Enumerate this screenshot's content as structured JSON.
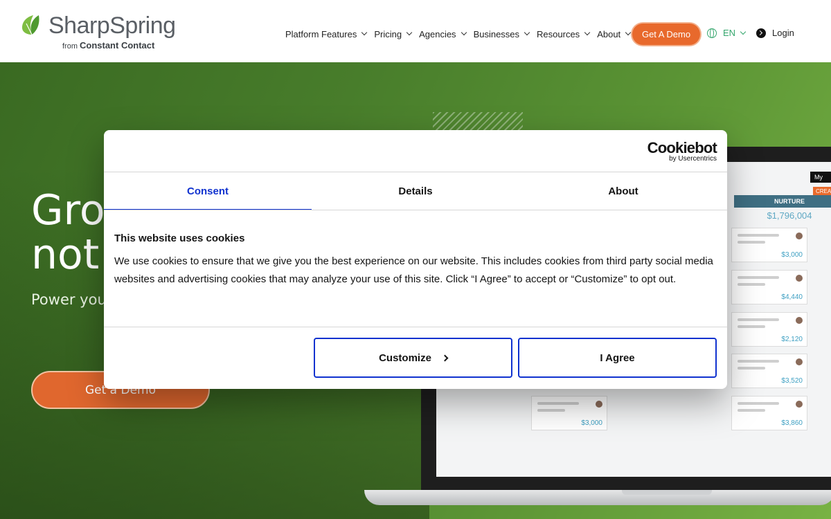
{
  "header": {
    "logo_word": "SharpSpring",
    "logo_from": "from",
    "logo_sub": "Constant Contact",
    "nav": [
      {
        "label": "Platform Features"
      },
      {
        "label": "Pricing"
      },
      {
        "label": "Agencies"
      },
      {
        "label": "Businesses"
      },
      {
        "label": "Resources"
      },
      {
        "label": "About"
      }
    ],
    "demo_label": "Get A Demo",
    "lang_label": "EN",
    "login_label": "Login"
  },
  "hero": {
    "title_line1": "Grow",
    "title_line2": "not y",
    "subtitle": "Power your where every sales.",
    "cta_label": "Get a Demo"
  },
  "mockup": {
    "tab_label": "My",
    "create_label": "CREATE",
    "stage_label": "NURTURE",
    "stage_total": "$1,796,004",
    "cards": [
      {
        "amount": "$3,000"
      },
      {
        "amount": "$4,440"
      },
      {
        "amount": "$2,120"
      },
      {
        "amount": "$3,520"
      },
      {
        "amount": "$3,860"
      }
    ],
    "left_card_amount": "$3,000"
  },
  "cookie_dialog": {
    "brand": "Cookiebot",
    "brand_sub": "by Usercentrics",
    "tabs": [
      {
        "label": "Consent"
      },
      {
        "label": "Details"
      },
      {
        "label": "About"
      }
    ],
    "title": "This website uses cookies",
    "body": "We use cookies to ensure that we give you the best experience on our website. This includes cookies from third party social media websites and advertising cookies that may analyze your use of this site. Click “I Agree” to accept or “Customize” to opt out.",
    "customize_label": "Customize",
    "agree_label": "I Agree"
  },
  "colors": {
    "accent_orange": "#e8692c",
    "cookiebot_blue": "#1032cf",
    "hero_green": "#487d2b",
    "lang_green": "#35a66d"
  }
}
